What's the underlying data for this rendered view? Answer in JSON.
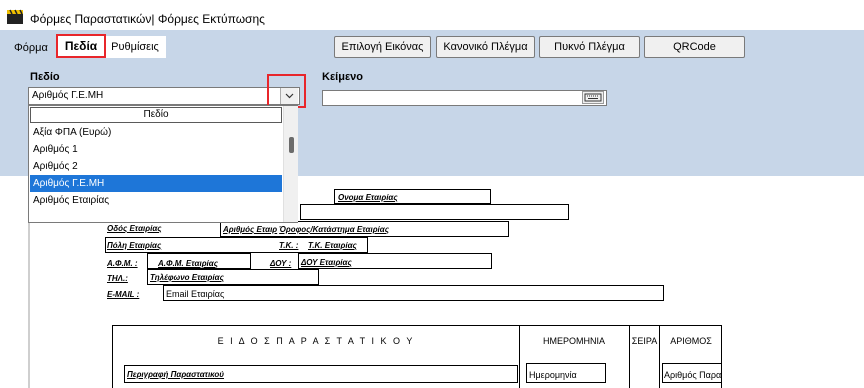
{
  "window": {
    "title": "Φόρμες Παραστατικών| Φόρμες Εκτύπωσης",
    "icon": "clapperboard-icon"
  },
  "tabs": [
    {
      "label": "Φόρμα"
    },
    {
      "label": "Πεδία",
      "active": true
    },
    {
      "label": "Ρυθμίσεις"
    }
  ],
  "toolbar": {
    "select_image": "Επιλογή Εικόνας",
    "normal_grid": "Κανονικό Πλέγμα",
    "dense_grid": "Πυκνό Πλέγμα",
    "qrcode": "QRCode"
  },
  "properties": {
    "field_label": "Πεδίο",
    "field_value": "Αριθμός Γ.Ε.ΜΗ",
    "text_label": "Κείμενο",
    "text_value": ""
  },
  "dropdown": {
    "header": "Πεδίο",
    "items": [
      "Αξία ΦΠΑ (Ευρώ)",
      "Αριθμός 1",
      "Αριθμός 2",
      "Αριθμός Γ.Ε.ΜΗ",
      "Αριθμός Εταιρίας"
    ],
    "selected_index": 3
  },
  "canvas": {
    "company_name_partial": "Ονομα Εταιρίας",
    "street": "Οδός Εταιρίας",
    "street_number": "Αριθμός Εταιρ",
    "floor": "Όροφος/Κατάστημα Εταιρίας",
    "city": "Πόλη Εταιρίας",
    "tk_label": "Τ.Κ. :",
    "tk": "Τ.Κ. Εταιρίας",
    "afm_label": "Α.Φ.Μ. :",
    "afm": "Α.Φ.Μ. Εταιρίας",
    "doy_label": "ΔΟΥ :",
    "doy": "ΔΟΥ Εταιρίας",
    "tel_label": "ΤΗΛ.:",
    "tel": "Τηλέφωνο Εταιρίας",
    "email_label": "E-MAIL :",
    "email": "Email Εταιρίας"
  },
  "table": {
    "doc_type_header": "Ε Ι Δ Ο Σ   Π Α Ρ Α Σ Τ Α Τ Ι Κ Ο Υ",
    "date_header": "ΗΜΕΡΟΜΗΝΙΑ",
    "series_header": "ΣΕΙΡΑ",
    "number_header": "ΑΡΙΘΜΟΣ",
    "doc_desc": "Περιγραφή Παραστατικού",
    "date_value": "Ημερομηνία",
    "number_value": "Αριθμός Παραστατ"
  },
  "colors": {
    "panel": "#c7d6e8",
    "selection": "#1e76d8",
    "highlight": "#e8262b"
  }
}
